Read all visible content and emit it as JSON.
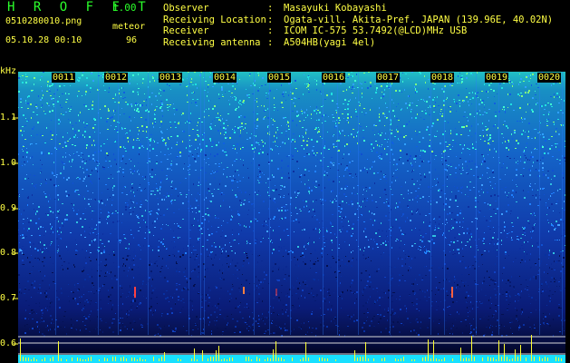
{
  "header": {
    "app_title": "H R O F F T",
    "version": "1.00",
    "file_name": "0510280010.png",
    "datetime": "05.10.28 00:10",
    "mode_label": "meteor",
    "count": "96"
  },
  "info": [
    {
      "label": "Observer",
      "value": "Masayuki Kobayashi"
    },
    {
      "label": "Receiving Location",
      "value": "Ogata-vill. Akita-Pref. JAPAN (139.96E, 40.02N)"
    },
    {
      "label": "Receiver",
      "value": "ICOM IC-575 53.7492(@LCD)MHz USB"
    },
    {
      "label": "Receiving antenna",
      "value": "A504HB(yagi 4el)"
    }
  ],
  "axes": {
    "y_unit": "kHz",
    "y_ticks": [
      "1.1",
      "1.0",
      "0.9",
      "0.8",
      "0.7",
      "0.6"
    ],
    "x_ticks": [
      "0011",
      "0012",
      "0013",
      "0014",
      "0015",
      "0016",
      "0017",
      "0018",
      "0019",
      "0020"
    ]
  },
  "colors": {
    "text": "#ffff44",
    "title": "#2bff2b"
  }
}
